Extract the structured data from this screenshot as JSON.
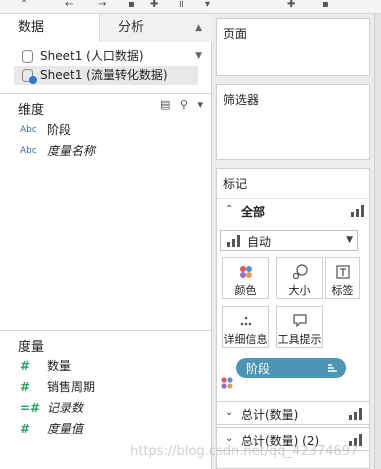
{
  "tabs": {
    "data": "数据",
    "analysis": "分析"
  },
  "datasources": [
    {
      "label": "Sheet1 (人口数据)"
    },
    {
      "label": "Sheet1 (流量转化数据)"
    }
  ],
  "dimensions": {
    "title": "维度",
    "fields": [
      {
        "type": "Abc",
        "label": "阶段"
      },
      {
        "type": "Abc",
        "label": "度量名称"
      }
    ]
  },
  "measures": {
    "title": "度量",
    "fields": [
      {
        "type": "#",
        "label": "数量"
      },
      {
        "type": "#",
        "label": "销售周期"
      },
      {
        "type": "=#",
        "label": "记录数"
      },
      {
        "type": "#",
        "label": "度量值"
      }
    ]
  },
  "cards": {
    "pages": "页面",
    "filters": "筛选器",
    "marks": "标记"
  },
  "marks": {
    "all_label": "全部",
    "mark_type": "自动",
    "buttons": {
      "color": "颜色",
      "size": "大小",
      "label": "标签",
      "detail": "详细信息",
      "tooltip": "工具提示"
    },
    "pill": "阶段",
    "sections": [
      "总计(数量)",
      "总计(数量) (2)"
    ]
  },
  "watermark": "https://blog.csdn.net/qq_42374697",
  "colors": {
    "pill": "#4c95b6",
    "accent": "#2a79c8"
  }
}
